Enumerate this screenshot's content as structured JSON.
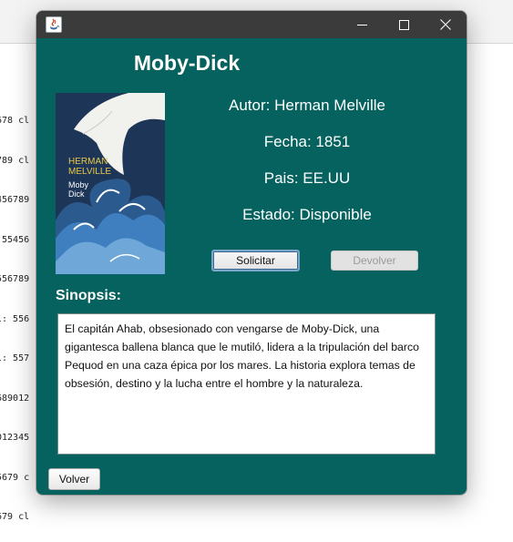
{
  "background": {
    "code_lines": [
      "678 cl",
      "789 cl",
      "456789",
      " 55456",
      "556789",
      "l: 556",
      "l: 557",
      "689012",
      "012345",
      "5679 c",
      "679 cl"
    ]
  },
  "window": {
    "icon": "java-icon",
    "controls": [
      "minimize-icon",
      "maximize-icon",
      "close-icon"
    ]
  },
  "book": {
    "title": "Moby-Dick",
    "cover": {
      "author_line1": "HERMAN",
      "author_line2": "MELVILLE",
      "title_line1": "Moby",
      "title_line2": "Dick"
    },
    "autor": "Autor: Herman Melville",
    "fecha": "Fecha: 1851",
    "pais": "Pais: EE.UU",
    "estado": "Estado: Disponible"
  },
  "buttons": {
    "solicitar": "Solicitar",
    "devolver": "Devolver",
    "volver": "Volver"
  },
  "sinopsis": {
    "label": "Sinopsis:",
    "text": "El capitán Ahab, obsesionado con vengarse de Moby-Dick, una gigantesca ballena blanca que le mutiló, lidera a la tripulación del barco Pequod en una caza épica por los mares. La historia explora temas de obsesión, destino y la lucha entre el hombre y la naturaleza."
  },
  "colors": {
    "dialog_bg": "#05625f",
    "titlebar_bg": "#3b3b3b",
    "cover_bg": "#1d3556",
    "cover_text": "#e8c84a"
  }
}
